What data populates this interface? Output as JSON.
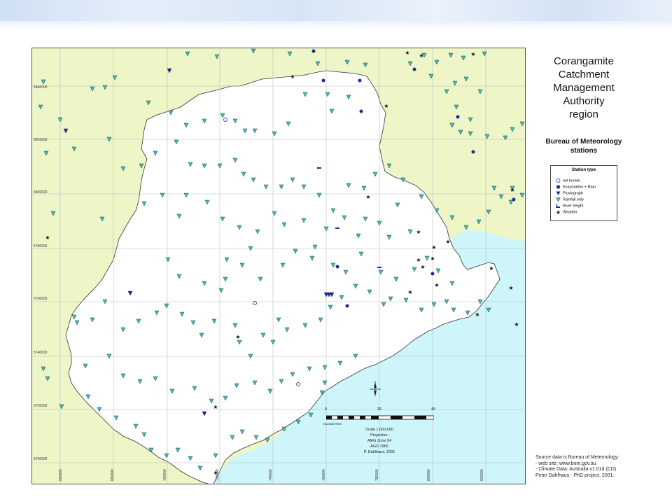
{
  "title": "Corangamite Catchment Management Authority region",
  "title_lines": [
    "Corangamite",
    "Catchment",
    "Management",
    "Authority",
    "region"
  ],
  "subtitle_lines": [
    "Bureau of Meteorology",
    "stations"
  ],
  "legend": {
    "title": "Station type",
    "items": [
      {
        "label": "not known",
        "symbol": "open-circle-icon",
        "color": "#3a3ad0"
      },
      {
        "label": "Evaporation + Rain",
        "symbol": "filled-circle-icon",
        "color": "#1a2a9a"
      },
      {
        "label": "Pluviograph",
        "symbol": "filled-triangle-icon",
        "color": "#1a2a9a"
      },
      {
        "label": "Rainfall only",
        "symbol": "teal-triangle-icon",
        "color": "#3cc4b4"
      },
      {
        "label": "River height",
        "symbol": "flag-icon",
        "color": "#1a2a9a"
      },
      {
        "label": "Weather",
        "symbol": "star-icon",
        "color": "#111111"
      }
    ]
  },
  "scale": {
    "label_0": "0",
    "label_20": "20",
    "label_40": "40",
    "unit": "KILOMETRES",
    "lines": [
      "Scale 1:600,000",
      "Projection:",
      "AMG Zone 54",
      "AGD 1966",
      "P. Dahlhaus, 2001"
    ]
  },
  "northing_labels": [
    "5840000",
    "5820000",
    "5800000",
    "5780000",
    "5760000",
    "5740000",
    "5720000",
    "5700000"
  ],
  "easting_labels": [
    "660000",
    "680000",
    "700000",
    "720000",
    "740000",
    "760000",
    "780000",
    "800000",
    "820000"
  ],
  "source_lines": [
    "Source data is Bureau of Meteorology:",
    "- web site: www.bom.gov.au",
    "- Climate Data: Australia v1.01d (CD)",
    "Peter Dahlhaus - PhD project, 2001."
  ],
  "colors": {
    "land_outside": "#eef5c6",
    "sea": "#cdf5fa",
    "region": "#ffffff",
    "station_teal": "#3cc4b4",
    "station_navy": "#1a2a9a"
  }
}
